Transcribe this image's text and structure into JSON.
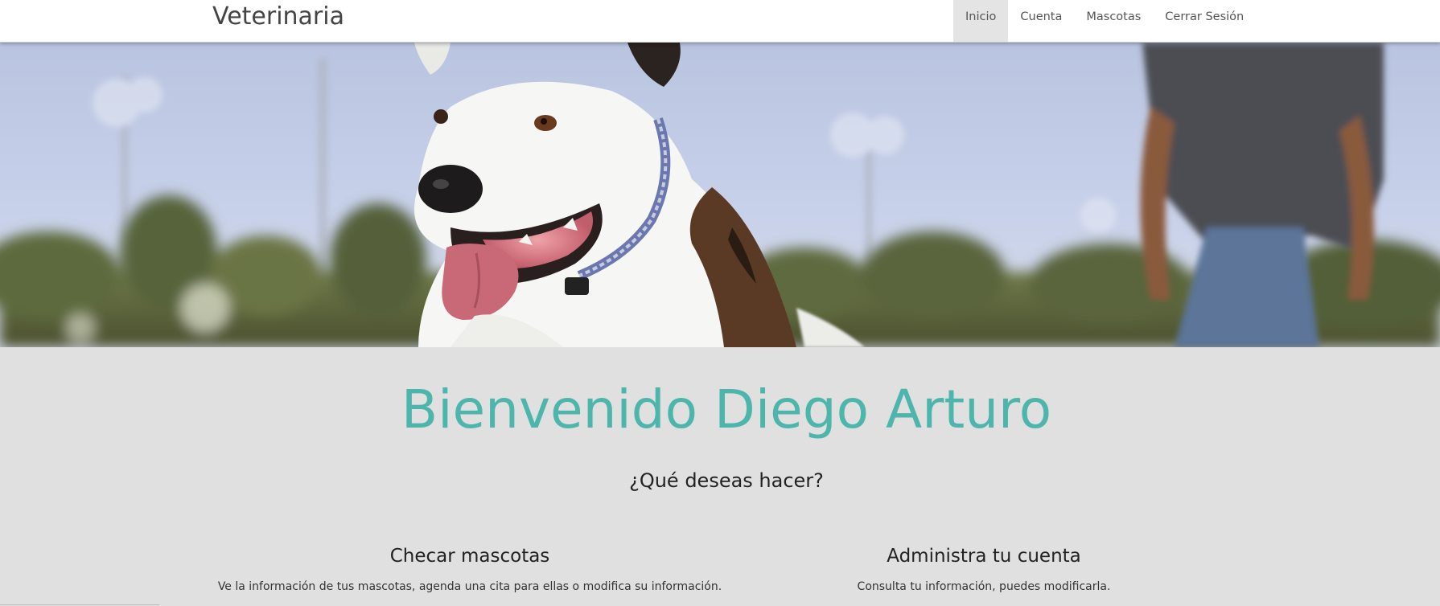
{
  "navbar": {
    "brand": "Veterinaria",
    "links": [
      {
        "label": "Inicio",
        "active": true
      },
      {
        "label": "Cuenta",
        "active": false
      },
      {
        "label": "Mascotas",
        "active": false
      },
      {
        "label": "Cerrar Sesión",
        "active": false
      }
    ]
  },
  "hero": {
    "image_subject": "smiling dog running in a park with a person behind"
  },
  "main": {
    "welcome": "Bienvenido Diego Arturo",
    "question": "¿Qué deseas hacer?",
    "cards": [
      {
        "title": "Checar mascotas",
        "description": "Ve la información de tus mascotas, agenda una cita para ellas o modifica su información."
      },
      {
        "title": "Administra tu cuenta",
        "description": "Consulta tu información, puedes modificarla."
      }
    ]
  },
  "colors": {
    "accent": "#4db6ac",
    "background": "#e0e0e0",
    "navbar": "#ffffff",
    "active_tab": "#e4e4e4"
  }
}
